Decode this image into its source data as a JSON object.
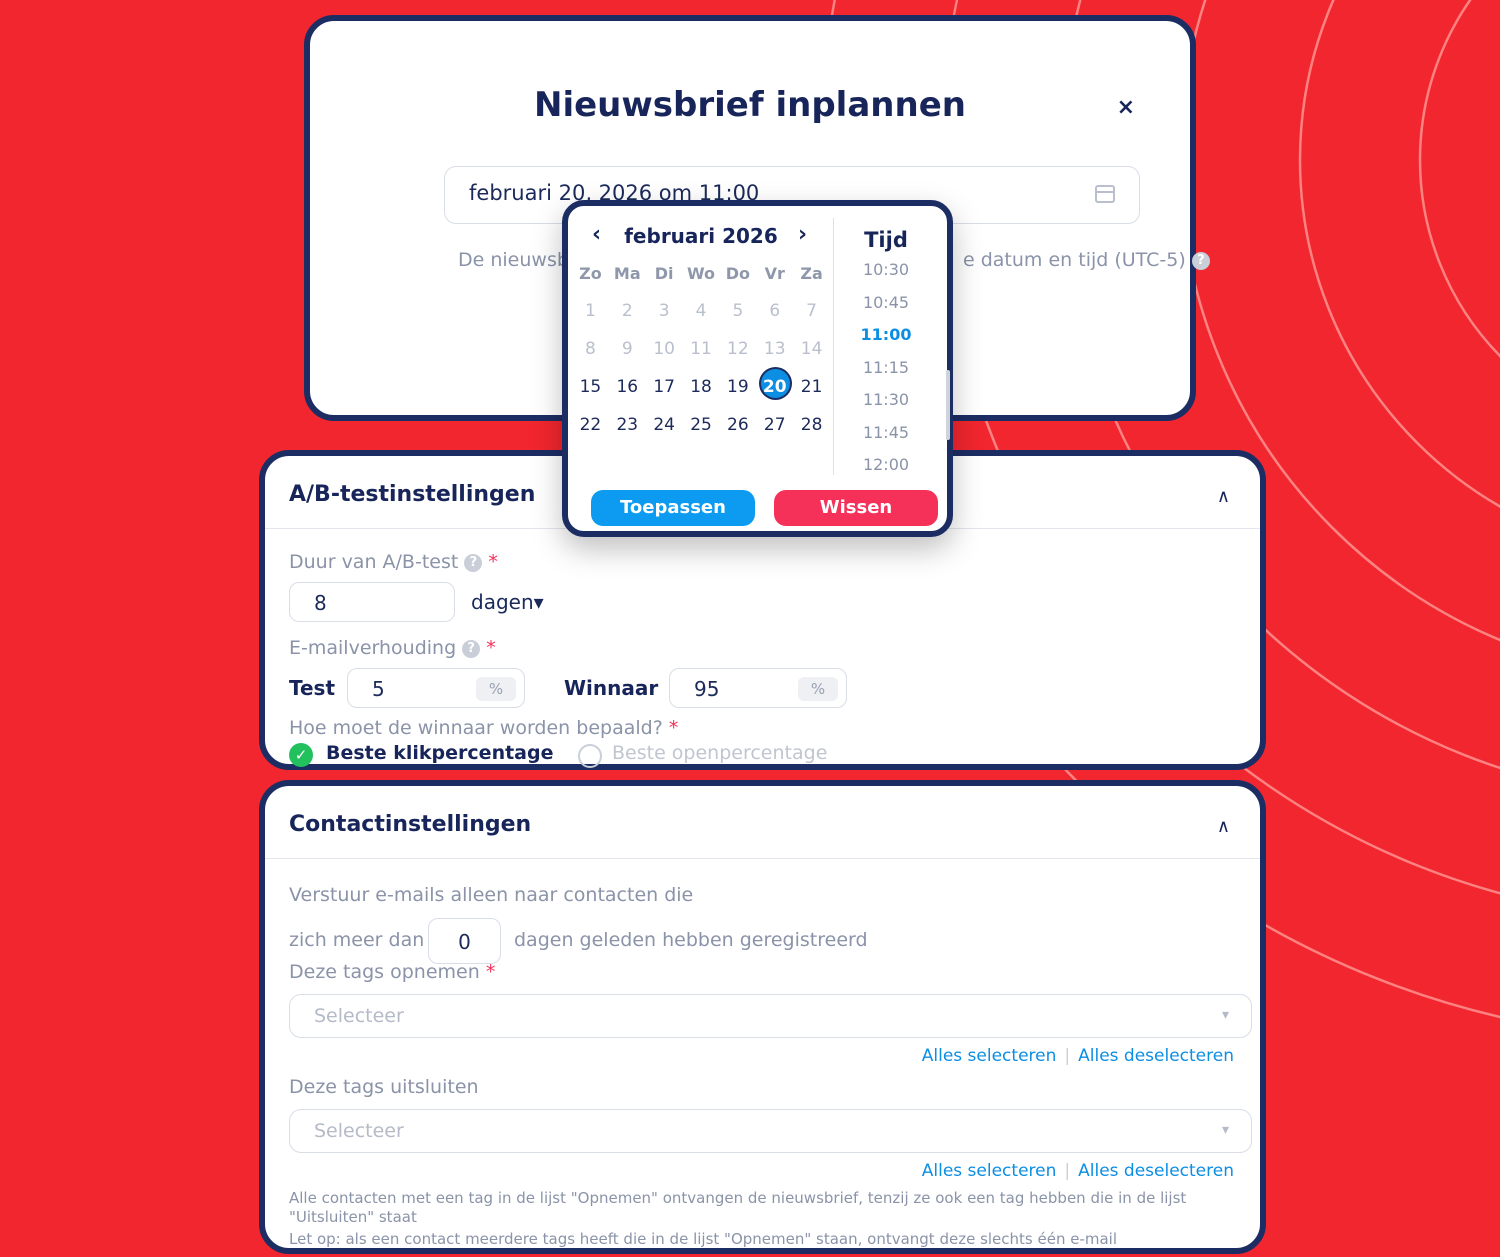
{
  "modal": {
    "title": "Nieuwsbrief inplannen",
    "close_icon": "×",
    "date_value": "februari 20, 2026 om 11:00",
    "help_left": "De nieuwsb",
    "help_right": "e datum en tijd (UTC-5)",
    "help_icon": "?"
  },
  "picker": {
    "prev": "‹",
    "next": "›",
    "month": "februari 2026",
    "weekdays": [
      "Zo",
      "Ma",
      "Di",
      "Wo",
      "Do",
      "Vr",
      "Za"
    ],
    "weeks": [
      [
        "1",
        "2",
        "3",
        "4",
        "5",
        "6",
        "7"
      ],
      [
        "8",
        "9",
        "10",
        "11",
        "12",
        "13",
        "14"
      ],
      [
        "15",
        "16",
        "17",
        "18",
        "19",
        "20",
        "21"
      ],
      [
        "22",
        "23",
        "24",
        "25",
        "26",
        "27",
        "28"
      ]
    ],
    "muted_weeks": 2,
    "selected_day": "20",
    "time_title": "Tijd",
    "times": [
      "10:30",
      "10:45",
      "11:00",
      "11:15",
      "11:30",
      "11:45",
      "12:00"
    ],
    "selected_time": "11:00",
    "apply_label": "Toepassen",
    "clear_label": "Wissen"
  },
  "ab": {
    "title": "A/B-testinstellingen",
    "toggle": "∧",
    "duration_label": "Duur van A/B-test",
    "duration_value": "8",
    "duration_unit": "dagen▾",
    "ratio_label": "E-mailverhouding",
    "test_label": "Test",
    "test_value": "5",
    "winner_label": "Winnaar",
    "winner_value": "95",
    "percent": "%",
    "winner_question": "Hoe moet de winnaar worden bepaald?",
    "option_click": "Beste klikpercentage",
    "option_open": "Beste openpercentage",
    "required_mark": "*",
    "help_icon": "?",
    "check_icon": "✓"
  },
  "contact": {
    "title": "Contactinstellingen",
    "toggle": "∧",
    "intro": "Verstuur e-mails alleen naar contacten die",
    "registered_prefix": "zich meer dan",
    "registered_days": "0",
    "registered_suffix": "dagen geleden hebben geregistreerd",
    "include_label": "Deze tags opnemen",
    "exclude_label": "Deze tags uitsluiten",
    "select_placeholder": "Selecteer",
    "caret": "▾",
    "select_all": "Alles selecteren",
    "deselect_all": "Alles deselecteren",
    "separator": "|",
    "required_mark": "*",
    "note1": "Alle contacten met een tag in de lijst \"Opnemen\" ontvangen de nieuwsbrief, tenzij ze ook een tag hebben die in de lijst \"Uitsluiten\" staat",
    "note2": "Let op: als een contact meerdere tags heeft die in de lijst \"Opnemen\" staan, ontvangt deze slechts één e-mail"
  },
  "colors": {
    "background": "#f1262e",
    "navy": "#1c2d63",
    "primary_blue": "#0c9bf0",
    "danger_pink": "#f5315a",
    "success_green": "#22c15e"
  }
}
